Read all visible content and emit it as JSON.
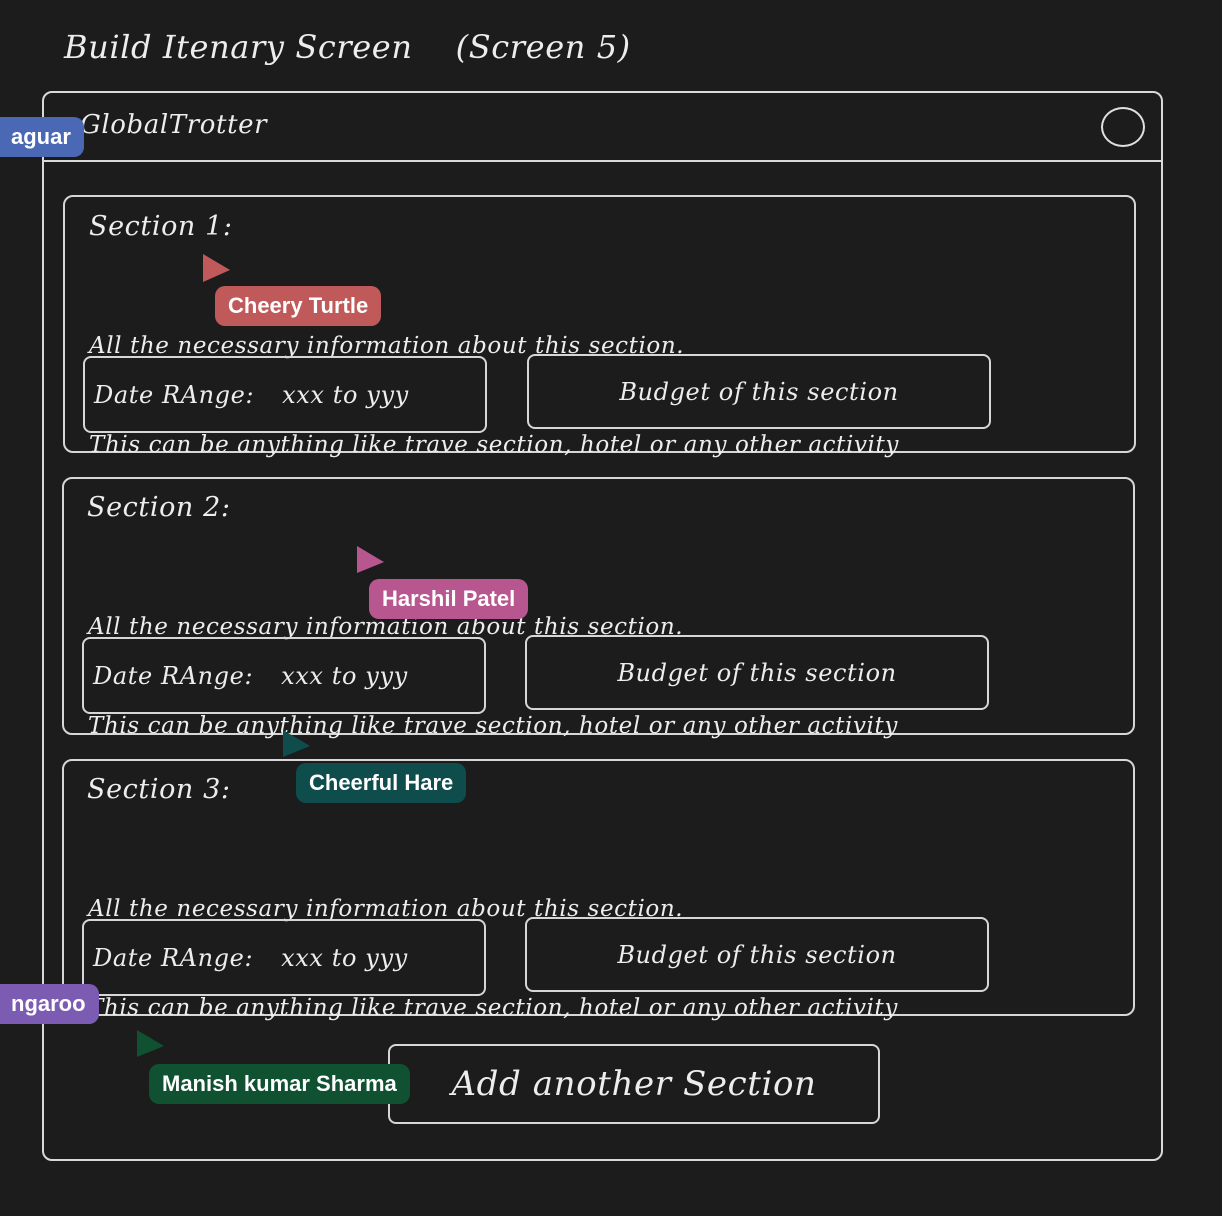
{
  "screen_title": "Build Itenary Screen    (Screen 5)",
  "app": {
    "title": "GlobalTrotter"
  },
  "sections": [
    {
      "title": "Section 1:",
      "desc_line1": "All the necessary information about this section.",
      "desc_line2": "This can be anything like trave section, hotel or any other activity",
      "date_label": "Date RAnge:",
      "date_value": "xxx to yyy",
      "budget_label": "Budget of this section"
    },
    {
      "title": "Section 2:",
      "desc_line1": "All the necessary information about this section.",
      "desc_line2": "This can be anything like trave section, hotel or any other activity",
      "date_label": "Date RAnge:",
      "date_value": "xxx to yyy",
      "budget_label": "Budget of this section"
    },
    {
      "title": "Section 3:",
      "desc_line1": "All the necessary information about this section.",
      "desc_line2": "This can be anything like trave section, hotel or any other activity",
      "date_label": "Date RAnge:",
      "date_value": "xxx to yyy",
      "budget_label": "Budget of this section"
    }
  ],
  "add_button_label": "Add another Section",
  "collaborators": [
    {
      "name": "aguar",
      "color": "#4a68b4"
    },
    {
      "name": "Cheery Turtle",
      "color": "#c05a5a"
    },
    {
      "name": "Harshil Patel",
      "color": "#b8568f"
    },
    {
      "name": "Cheerful Hare",
      "color": "#0f4d4d"
    },
    {
      "name": "ngaroo",
      "color": "#7c5cb3"
    },
    {
      "name": "Manish kumar Sharma",
      "color": "#0f5130"
    }
  ]
}
